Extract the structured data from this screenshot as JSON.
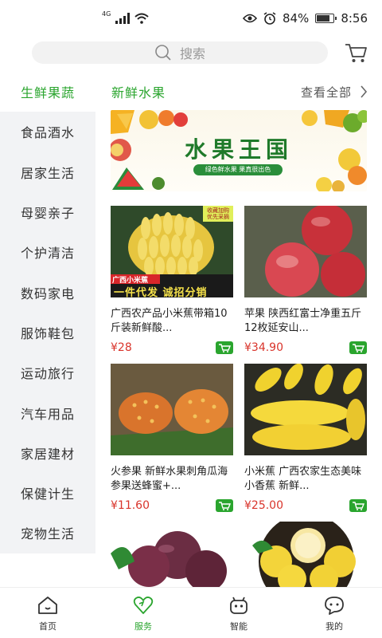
{
  "status_bar": {
    "network_tag": "4G",
    "battery_percent": "84%",
    "battery_level": 0.84,
    "time": "8:56"
  },
  "search": {
    "placeholder": "搜索"
  },
  "sidebar": {
    "items": [
      {
        "label": "生鲜果蔬",
        "active": true
      },
      {
        "label": "食品酒水"
      },
      {
        "label": "居家生活"
      },
      {
        "label": "母婴亲子"
      },
      {
        "label": "个护清洁"
      },
      {
        "label": "数码家电"
      },
      {
        "label": "服饰鞋包"
      },
      {
        "label": "运动旅行"
      },
      {
        "label": "汽车用品"
      },
      {
        "label": "家居建材"
      },
      {
        "label": "保健计生"
      },
      {
        "label": "宠物生活"
      }
    ]
  },
  "section": {
    "title": "新鲜水果",
    "see_all": "查看全部"
  },
  "banner": {
    "title": "水果王国",
    "subtitle": "绿色鲜水果 果真很出色"
  },
  "products": [
    {
      "name": "广西农产品小米蕉带箱10斤装新鲜酸...",
      "price": "¥28",
      "tag_top": "收藏加购 优先采摘",
      "tag_bottom_1": "广西小米蕉",
      "tag_bottom_2": "一件代发 诚招分销"
    },
    {
      "name": "苹果 陕西红富士净重五斤12枚延安山...",
      "price": "¥34.90"
    },
    {
      "name": "火参果 新鲜水果刺角瓜海参果送蜂蜜+...",
      "price": "¥11.60"
    },
    {
      "name": "小米蕉 广西农家生态美味小香蕉 新鲜...",
      "price": "¥25.00"
    },
    {
      "name": "",
      "price": ""
    },
    {
      "name": "",
      "price": ""
    }
  ],
  "bottom_nav": [
    {
      "label": "首页",
      "icon": "home-icon"
    },
    {
      "label": "服务",
      "icon": "heart-icon",
      "active": true
    },
    {
      "label": "智能",
      "icon": "robot-icon"
    },
    {
      "label": "我的",
      "icon": "chat-icon"
    }
  ],
  "colors": {
    "accent": "#2aa52e",
    "price": "#d9342b",
    "sidebar_bg": "#f2f3f5"
  }
}
